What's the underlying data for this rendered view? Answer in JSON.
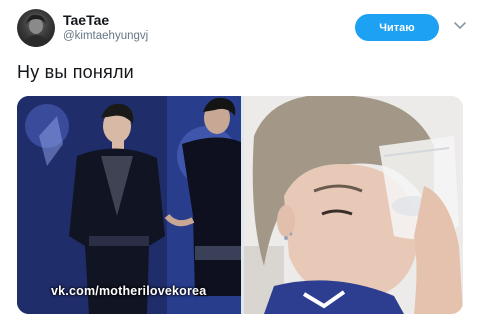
{
  "author": {
    "display_name": "TaeTae",
    "handle": "@kimtaehyungvj",
    "avatar_icon": "profile-avatar"
  },
  "follow_button": {
    "label": "Читаю"
  },
  "menu": {
    "icon": "chevron-down-icon"
  },
  "tweet": {
    "text": "Ну вы поняли"
  },
  "media": {
    "left_photo": {
      "watermark": "vk.com/motherilovekorea"
    }
  },
  "colors": {
    "accent": "#1da1f2",
    "text_primary": "#14171a",
    "text_secondary": "#657786"
  }
}
